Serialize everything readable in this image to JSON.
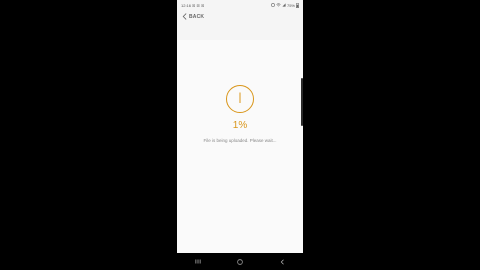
{
  "status_bar": {
    "time": "12:16",
    "notifications": "⊠ ⊠ ⊠",
    "battery_pct": "75%"
  },
  "header": {
    "back_label": "BACK"
  },
  "upload": {
    "progress": 0.01,
    "percent_label": "1%",
    "message": "File is being uploaded. Please wait..."
  },
  "colors": {
    "accent": "#d9961a",
    "screen_bg": "#fafafa",
    "frame_bg": "#000000"
  },
  "icons": {
    "back": "chevron-left-icon",
    "nav_recents": "recents-icon",
    "nav_home": "home-icon",
    "nav_back": "back-icon"
  }
}
